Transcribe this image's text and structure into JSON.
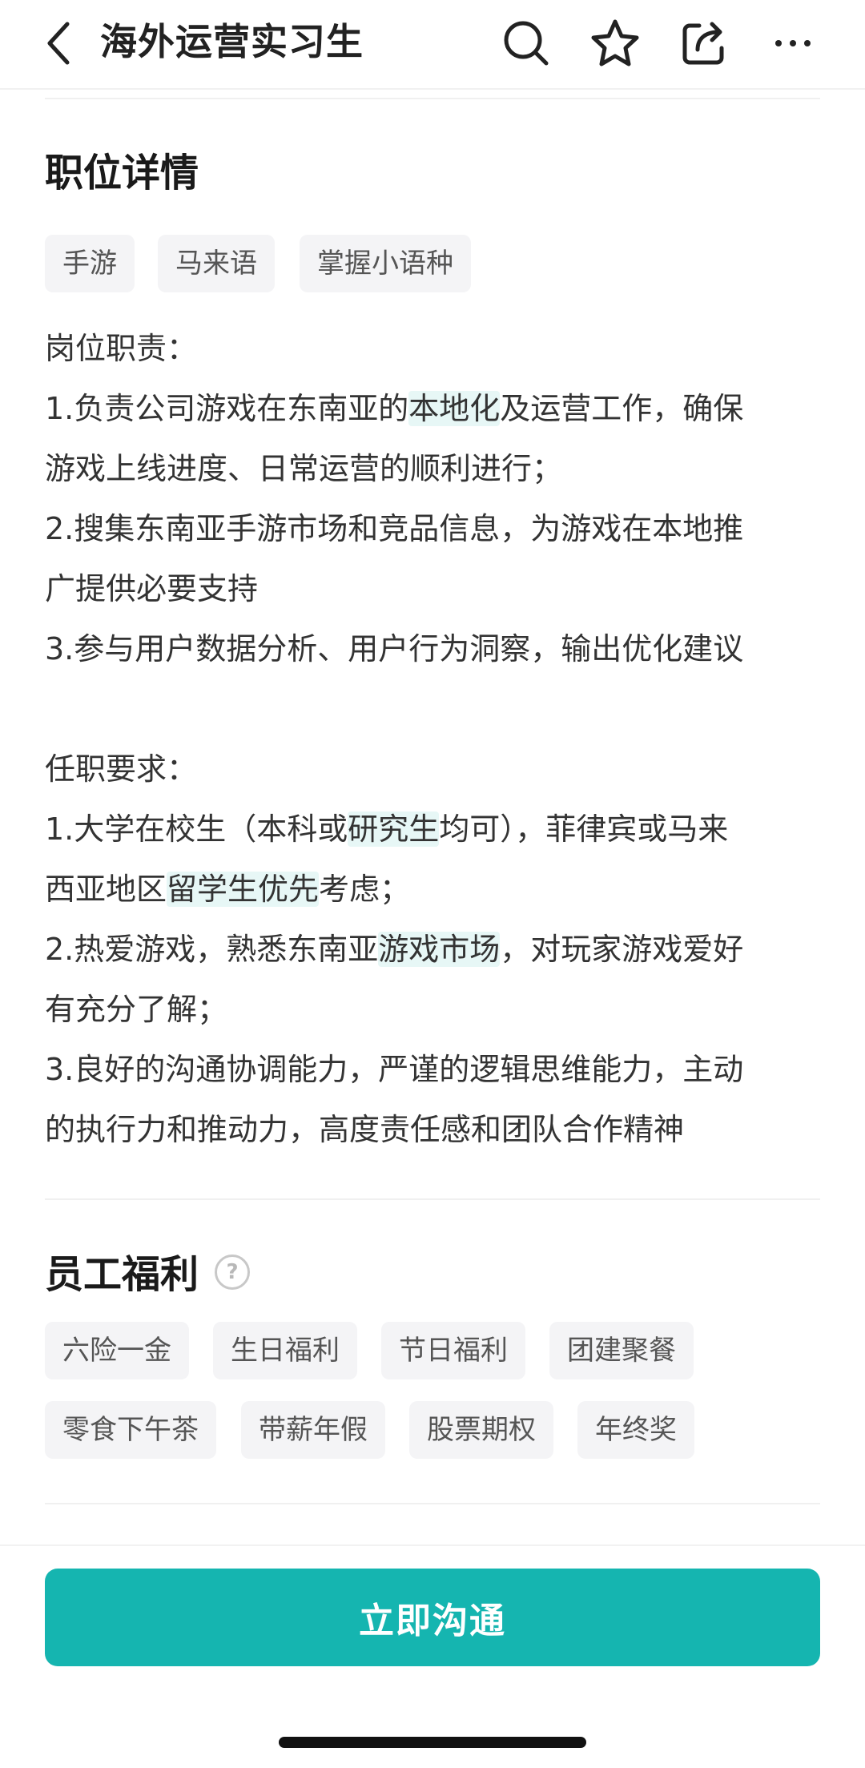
{
  "nav": {
    "title": "海外运营实习生",
    "icons": [
      "back-icon",
      "search-icon",
      "star-icon",
      "share-icon",
      "more-icon"
    ]
  },
  "job_detail": {
    "title": "职位详情",
    "tags": [
      "手游",
      "马来语",
      "掌握小语种"
    ],
    "responsibilities_heading": "岗位职责：",
    "responsibilities": [
      [
        "1.负责公司游戏在东南亚的",
        "本地化",
        "及运营工作，确保"
      ],
      [
        "游戏上线进度、日常运营的顺利进行；"
      ],
      [
        "2.搜集东南亚手游市场和竞品信息，为游戏在本地推"
      ],
      [
        "广提供必要支持"
      ],
      [
        "3.参与用户数据分析、用户行为洞察，输出优化建议"
      ]
    ],
    "requirements_heading": "任职要求：",
    "requirements": [
      [
        "1.大学在校生（本科或",
        "研究生",
        "均可），菲律宾或马来"
      ],
      [
        "西亚地区",
        "留学生优先",
        "考虑；"
      ],
      [
        "2.热爱游戏，熟悉东南亚",
        "游戏市场",
        "，对玩家游戏爱好"
      ],
      [
        "有充分了解；"
      ],
      [
        "3.良好的沟通协调能力，严谨的逻辑思维能力，主动"
      ],
      [
        "的执行力和推动力，高度责任感和团队合作精神"
      ]
    ]
  },
  "benefits": {
    "title": "员工福利",
    "help_glyph": "?",
    "tags": [
      "六险一金",
      "生日福利",
      "节日福利",
      "团建聚餐",
      "零食下午茶",
      "带薪年假",
      "股票期权",
      "年终奖"
    ]
  },
  "cta": {
    "label": "立即沟通"
  },
  "colors": {
    "accent": "#15b5b0",
    "highlight": "#e7f7f6",
    "tag_bg": "#f4f4f6"
  }
}
